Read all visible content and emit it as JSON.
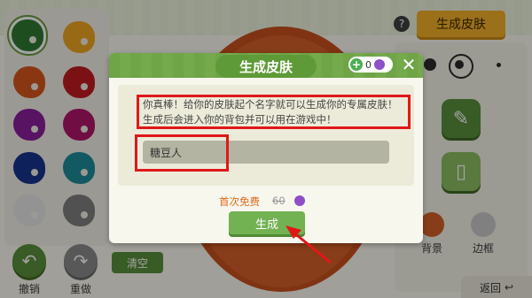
{
  "dialog": {
    "title": "生成皮肤",
    "coin_count": "0",
    "close_icon": "close-icon",
    "message": "你真棒！给你的皮肤起个名字就可以生成你的专属皮肤！生成后会进入你的背包并可以用在游戏中！",
    "name_input_value": "糖豆人",
    "first_free_label": "首次免费",
    "original_price": "60",
    "generate_label": "生成"
  },
  "top_bar": {
    "help_label": "?",
    "generate_skin_label": "生成皮肤"
  },
  "left_toolbar": {
    "undo_label": "撤销",
    "redo_label": "重做",
    "clear_label": "清空"
  },
  "right_panel": {
    "background_label": "背景",
    "border_label": "边框"
  },
  "bottom": {
    "back_label": "返回"
  },
  "palette": {
    "colors": [
      "#2f7a32",
      "#f0a623",
      "#d7561f",
      "#c21c22",
      "#8a1e9c",
      "#b0166b",
      "#16348f",
      "#1f8b9a",
      "#e6e6e6",
      "#7f7f7f"
    ]
  },
  "accent_colors": {
    "green": "#72b253",
    "highlight_red": "#e01818",
    "orange_text": "#e06a1a",
    "yellow_button": "#f3b02a"
  }
}
